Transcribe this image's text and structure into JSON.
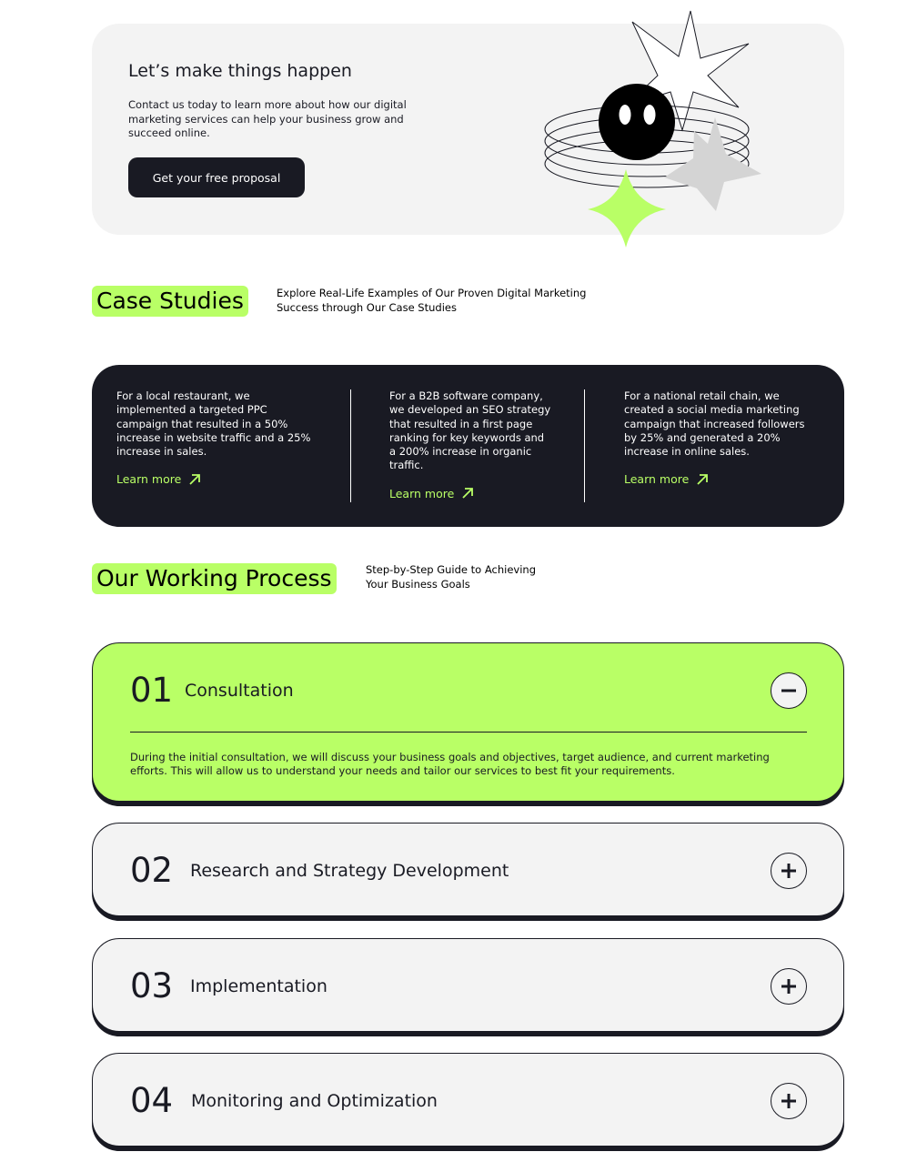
{
  "cta": {
    "title": "Let’s make things happen",
    "text": "Contact us today to learn more about how our digital marketing services can help your business grow and succeed online.",
    "button_label": "Get your free proposal"
  },
  "case_studies": {
    "title": "Case Studies",
    "description": "Explore Real-Life Examples of Our Proven Digital Marketing Success through Our Case Studies",
    "items": [
      {
        "text": "For a local restaurant, we implemented a targeted PPC campaign that resulted in a 50% increase in website traffic and a 25% increase in sales.",
        "link": "Learn more"
      },
      {
        "text": "For a B2B software company, we developed an SEO strategy that resulted in a first page ranking for key keywords and a 200% increase in organic traffic.",
        "link": "Learn more"
      },
      {
        "text": "For a national retail chain, we created a social media marketing campaign that increased followers by 25% and generated a 20% increase in online sales.",
        "link": "Learn more"
      }
    ]
  },
  "process": {
    "title": "Our Working Process",
    "description": "Step-by-Step Guide to Achieving Your Business Goals",
    "steps": [
      {
        "number": "01",
        "title": "Consultation",
        "expanded": true,
        "description": "During the initial consultation, we will discuss your business goals and objectives, target audience, and current marketing efforts. This will allow us to understand your needs and tailor our services to best fit your requirements."
      },
      {
        "number": "02",
        "title": "Research and Strategy Development",
        "expanded": false
      },
      {
        "number": "03",
        "title": "Implementation",
        "expanded": false
      },
      {
        "number": "04",
        "title": "Monitoring and Optimization",
        "expanded": false
      }
    ]
  },
  "colors": {
    "accent": "#b9ff66",
    "dark": "#191a23",
    "light": "#f3f3f3"
  },
  "icons": {
    "case_link": "arrow-up-right-icon",
    "collapse": "minus-icon",
    "expand": "plus-icon"
  }
}
